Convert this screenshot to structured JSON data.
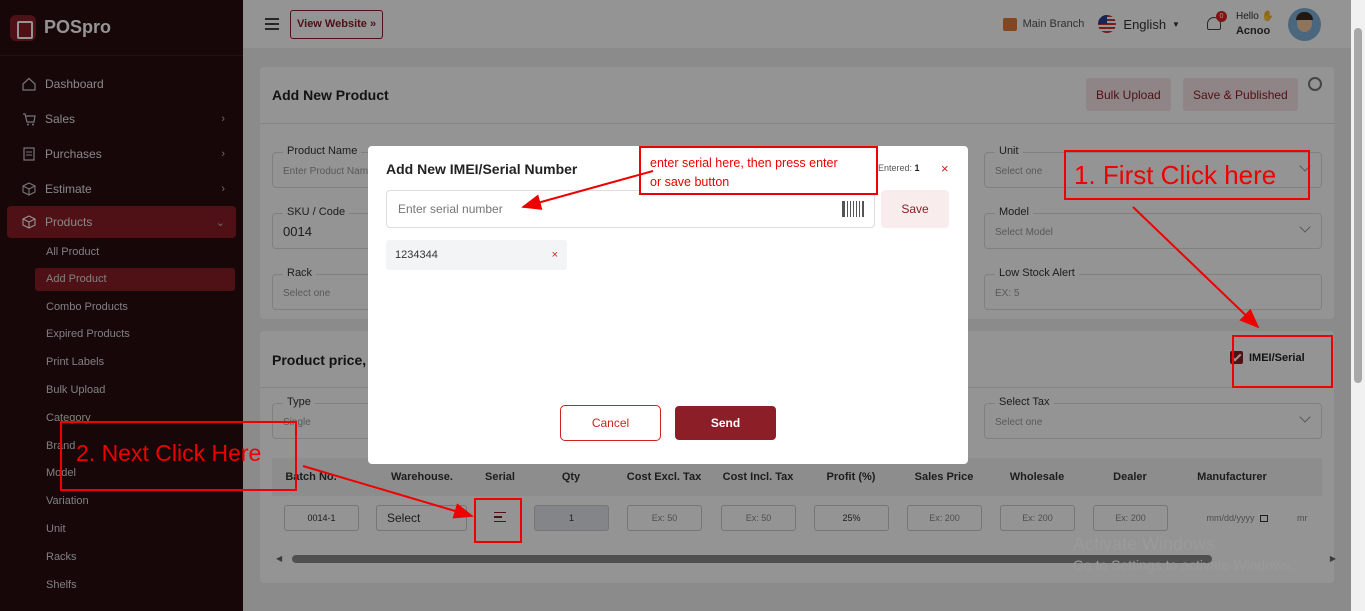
{
  "app": {
    "name": "POSpro"
  },
  "sidebar": {
    "items": [
      {
        "label": "Dashboard",
        "icon": "home-icon",
        "has_children": false
      },
      {
        "label": "Sales",
        "icon": "cart-icon",
        "has_children": true
      },
      {
        "label": "Purchases",
        "icon": "receipt-icon",
        "has_children": true
      },
      {
        "label": "Estimate",
        "icon": "box-icon",
        "has_children": true
      },
      {
        "label": "Products",
        "icon": "cube-icon",
        "has_children": true,
        "active": true
      }
    ],
    "sub_items": [
      "All Product",
      "Add Product",
      "Combo Products",
      "Expired Products",
      "Print Labels",
      "Bulk Upload",
      "Category",
      "Brand",
      "Model",
      "Variation",
      "Unit",
      "Racks",
      "Shelfs"
    ],
    "active_sub": "Add Product"
  },
  "topbar": {
    "view_website": "View Website",
    "branch": "Main Branch",
    "language": "English",
    "notification_count": "0",
    "greeting": "Hello",
    "user": "Acnoo"
  },
  "page": {
    "title": "Add New Product",
    "bulk_upload": "Bulk Upload",
    "save_published": "Save & Published",
    "fields": {
      "product_name": {
        "label": "Product Name",
        "placeholder": "Enter Product Name"
      },
      "unit": {
        "label": "Unit",
        "placeholder": "Select one"
      },
      "sku": {
        "label": "SKU / Code",
        "value": "0014"
      },
      "model": {
        "label": "Model",
        "placeholder": "Select Model"
      },
      "rack": {
        "label": "Rack",
        "placeholder": "Select one"
      },
      "low_stock": {
        "label": "Low Stock Alert",
        "placeholder": "EX: 5"
      },
      "type": {
        "label": "Type",
        "placeholder": "Single"
      },
      "tax": {
        "label": "Select Tax",
        "placeholder": "Select one"
      }
    },
    "price_title": "Product price, s",
    "imei_label": "IMEI/Serial",
    "table": {
      "headers": [
        "Batch No.",
        "Warehouse.",
        "Serial",
        "Qty",
        "Cost Excl. Tax",
        "Cost Incl. Tax",
        "Profit (%)",
        "Sales Price",
        "Wholesale",
        "Dealer",
        "Manufacturer"
      ],
      "row": {
        "batch": "0014-1",
        "warehouse": "Select",
        "qty": "1",
        "cost_excl": "Ex: 50",
        "cost_incl": "Ex: 50",
        "profit": "25%",
        "sales": "Ex: 200",
        "wholesale": "Ex: 200",
        "dealer": "Ex: 200",
        "manufacturer": "mm/dd/yyyy",
        "extra": "mr"
      }
    }
  },
  "modal": {
    "title": "Add New IMEI/Serial Number",
    "entered_label": "Entered:",
    "entered_count": "1",
    "close": "×",
    "input_placeholder": "Enter serial number",
    "save": "Save",
    "serials": [
      {
        "value": "1234344",
        "remove": "×"
      }
    ],
    "cancel": "Cancel",
    "send": "Send"
  },
  "annotations": {
    "first": "1. First Click here",
    "next": "2. Next Click Here",
    "serial_hint_1": "enter serial here, then press enter",
    "serial_hint_2": "or save button"
  },
  "watermark": {
    "line1": "Activate Windows",
    "line2": "Go to Settings to activate Windows."
  },
  "colors": {
    "brand": "#8b1e26",
    "sidebar": "#2a0d0f",
    "annotation": "#e00000"
  }
}
